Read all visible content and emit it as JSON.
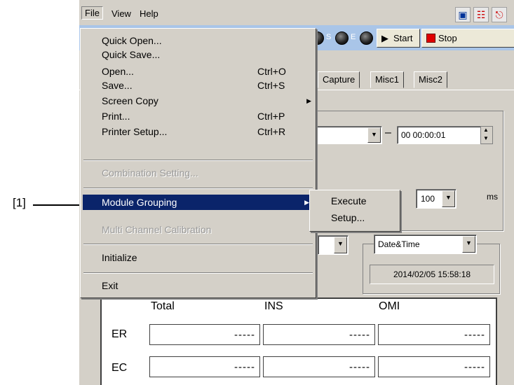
{
  "annotation": {
    "label": "[1]"
  },
  "menubar": {
    "file": "File",
    "view": "View",
    "help": "Help"
  },
  "toolbar": {
    "led_s": "S",
    "led_e": "E",
    "start": "Start",
    "stop": "Stop"
  },
  "tabs": [
    "Capture",
    "Misc1",
    "Misc2"
  ],
  "controls": {
    "end_time": "00 00:00:01",
    "dash": "–",
    "interval_value": "100",
    "interval_unit": "ms",
    "time_mode": "Date&Time",
    "timestamp": "2014/02/05 15:58:18"
  },
  "file_menu": {
    "items": [
      {
        "label": "Quick Open...",
        "shortcut": ""
      },
      {
        "label": "Quick Save...",
        "shortcut": ""
      },
      {
        "label": "Open...",
        "shortcut": "Ctrl+O"
      },
      {
        "label": "Save...",
        "shortcut": "Ctrl+S"
      },
      {
        "label": "Screen Copy",
        "shortcut": ""
      },
      {
        "label": "Print...",
        "shortcut": "Ctrl+P"
      },
      {
        "label": "Printer Setup...",
        "shortcut": "Ctrl+R"
      },
      {
        "label": "Combination Setting...",
        "shortcut": ""
      },
      {
        "label": "Module Grouping",
        "shortcut": ""
      },
      {
        "label": "Multi Channel Calibration",
        "shortcut": ""
      },
      {
        "label": "Initialize",
        "shortcut": ""
      },
      {
        "label": "Exit",
        "shortcut": ""
      }
    ]
  },
  "submenu": {
    "items": [
      "Execute",
      "Setup..."
    ]
  },
  "grid": {
    "columns": [
      "Total",
      "INS",
      "OMI"
    ],
    "rows": [
      {
        "label": "ER",
        "values": [
          "-----",
          "-----",
          "-----"
        ]
      },
      {
        "label": "EC",
        "values": [
          "-----",
          "-----",
          "-----"
        ]
      }
    ]
  }
}
